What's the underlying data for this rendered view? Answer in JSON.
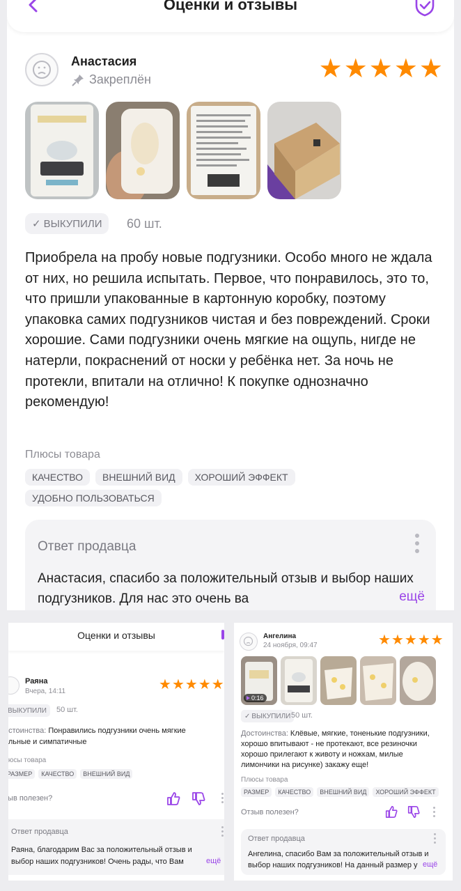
{
  "top": {
    "header_title": "Оценки и отзывы",
    "review": {
      "author": "Анастасия",
      "pinned": "Закреплён",
      "stars": "★★★★★",
      "bought_label": "ВЫКУПИЛИ",
      "quantity": "60 шт.",
      "text": "Приобрела на пробу новые подгузники. Особо много не ждала от них, но решила испытать. Первое, что понравилось, это то, что пришли упакованные в картонную коробку, поэтому упаковка самих подгузников чистая и без повреждений. Сроки хорошие. Сами подгузники очень мягкие на ощупь, нигде не натерли, покраснений от носки у ребёнка нет. За ночь не протекли, впитали на отлично! К покупке однозначно рекомендую!",
      "plus_title": "Плюсы товара",
      "tags": [
        "КАЧЕСТВО",
        "ВНЕШНИЙ ВИД",
        "ХОРОШИЙ ЭФФЕКТ",
        "УДОБНО ПОЛЬЗОВАТЬСЯ"
      ],
      "seller_title": "Ответ продавца",
      "seller_text": "Анастасия, спасибо за положительный отзыв и выбор наших подгузников. Для нас это очень ва",
      "more": "ещё"
    }
  },
  "bottom_left": {
    "header_title": "Оценки и отзывы",
    "author": "Раяна",
    "date": "Вчера, 14:11",
    "stars": "★★★★★",
    "bought_label": "ВЫКУПИЛИ",
    "quantity": "50 шт.",
    "pros_label": "остоинства:",
    "pros_text_1": " Понравились подгузники очень мягкие",
    "pros_text_2": "ольные и симпатичные",
    "plus_title": "люсы товара",
    "tags": [
      "РАЗМЕР",
      "КАЧЕСТВО",
      "ВНЕШНИЙ ВИД"
    ],
    "useful": "зыв полезен?",
    "seller_title": "Ответ продавца",
    "seller_text_1": "Раяна, благодарим Вас за положительный отзыв и",
    "seller_text_2": "выбор наших подгузников! Очень рады, что Вам",
    "more": "ещё"
  },
  "bottom_right": {
    "author": "Ангелина",
    "date": "24 ноября, 09:47",
    "stars": "★★★★★",
    "video_time": "0:16",
    "bought_label": "ВЫКУПИЛИ",
    "quantity": "50 шт.",
    "pros_label": "Достоинства:",
    "pros_text_1": " Клёвые, мягкие, тоненькие подгузники,",
    "pros_text_2": "хорошо впитывают  - не протекают,  все резиночки",
    "pros_text_3": "хорошо прилегают к животу и ножкам,  милые",
    "pros_text_4": "лимончики на рисунке) закажу еще!",
    "plus_title": "Плюсы товара",
    "tags": [
      "РАЗМЕР",
      "КАЧЕСТВО",
      "ВНЕШНИЙ ВИД",
      "ХОРОШИЙ ЭФФЕКТ"
    ],
    "useful": "Отзыв полезен?",
    "seller_title": "Ответ продавца",
    "seller_text_1": "Ангелина, спасибо Вам за положительный отзыв и",
    "seller_text_2": "выбор наших подгузников! На данный размер у",
    "more": "ещё"
  },
  "colors": {
    "accent": "#9a45e8",
    "star": "#ff8a00",
    "tag_bg": "#f1f1f4",
    "muted": "#8c8c93"
  }
}
